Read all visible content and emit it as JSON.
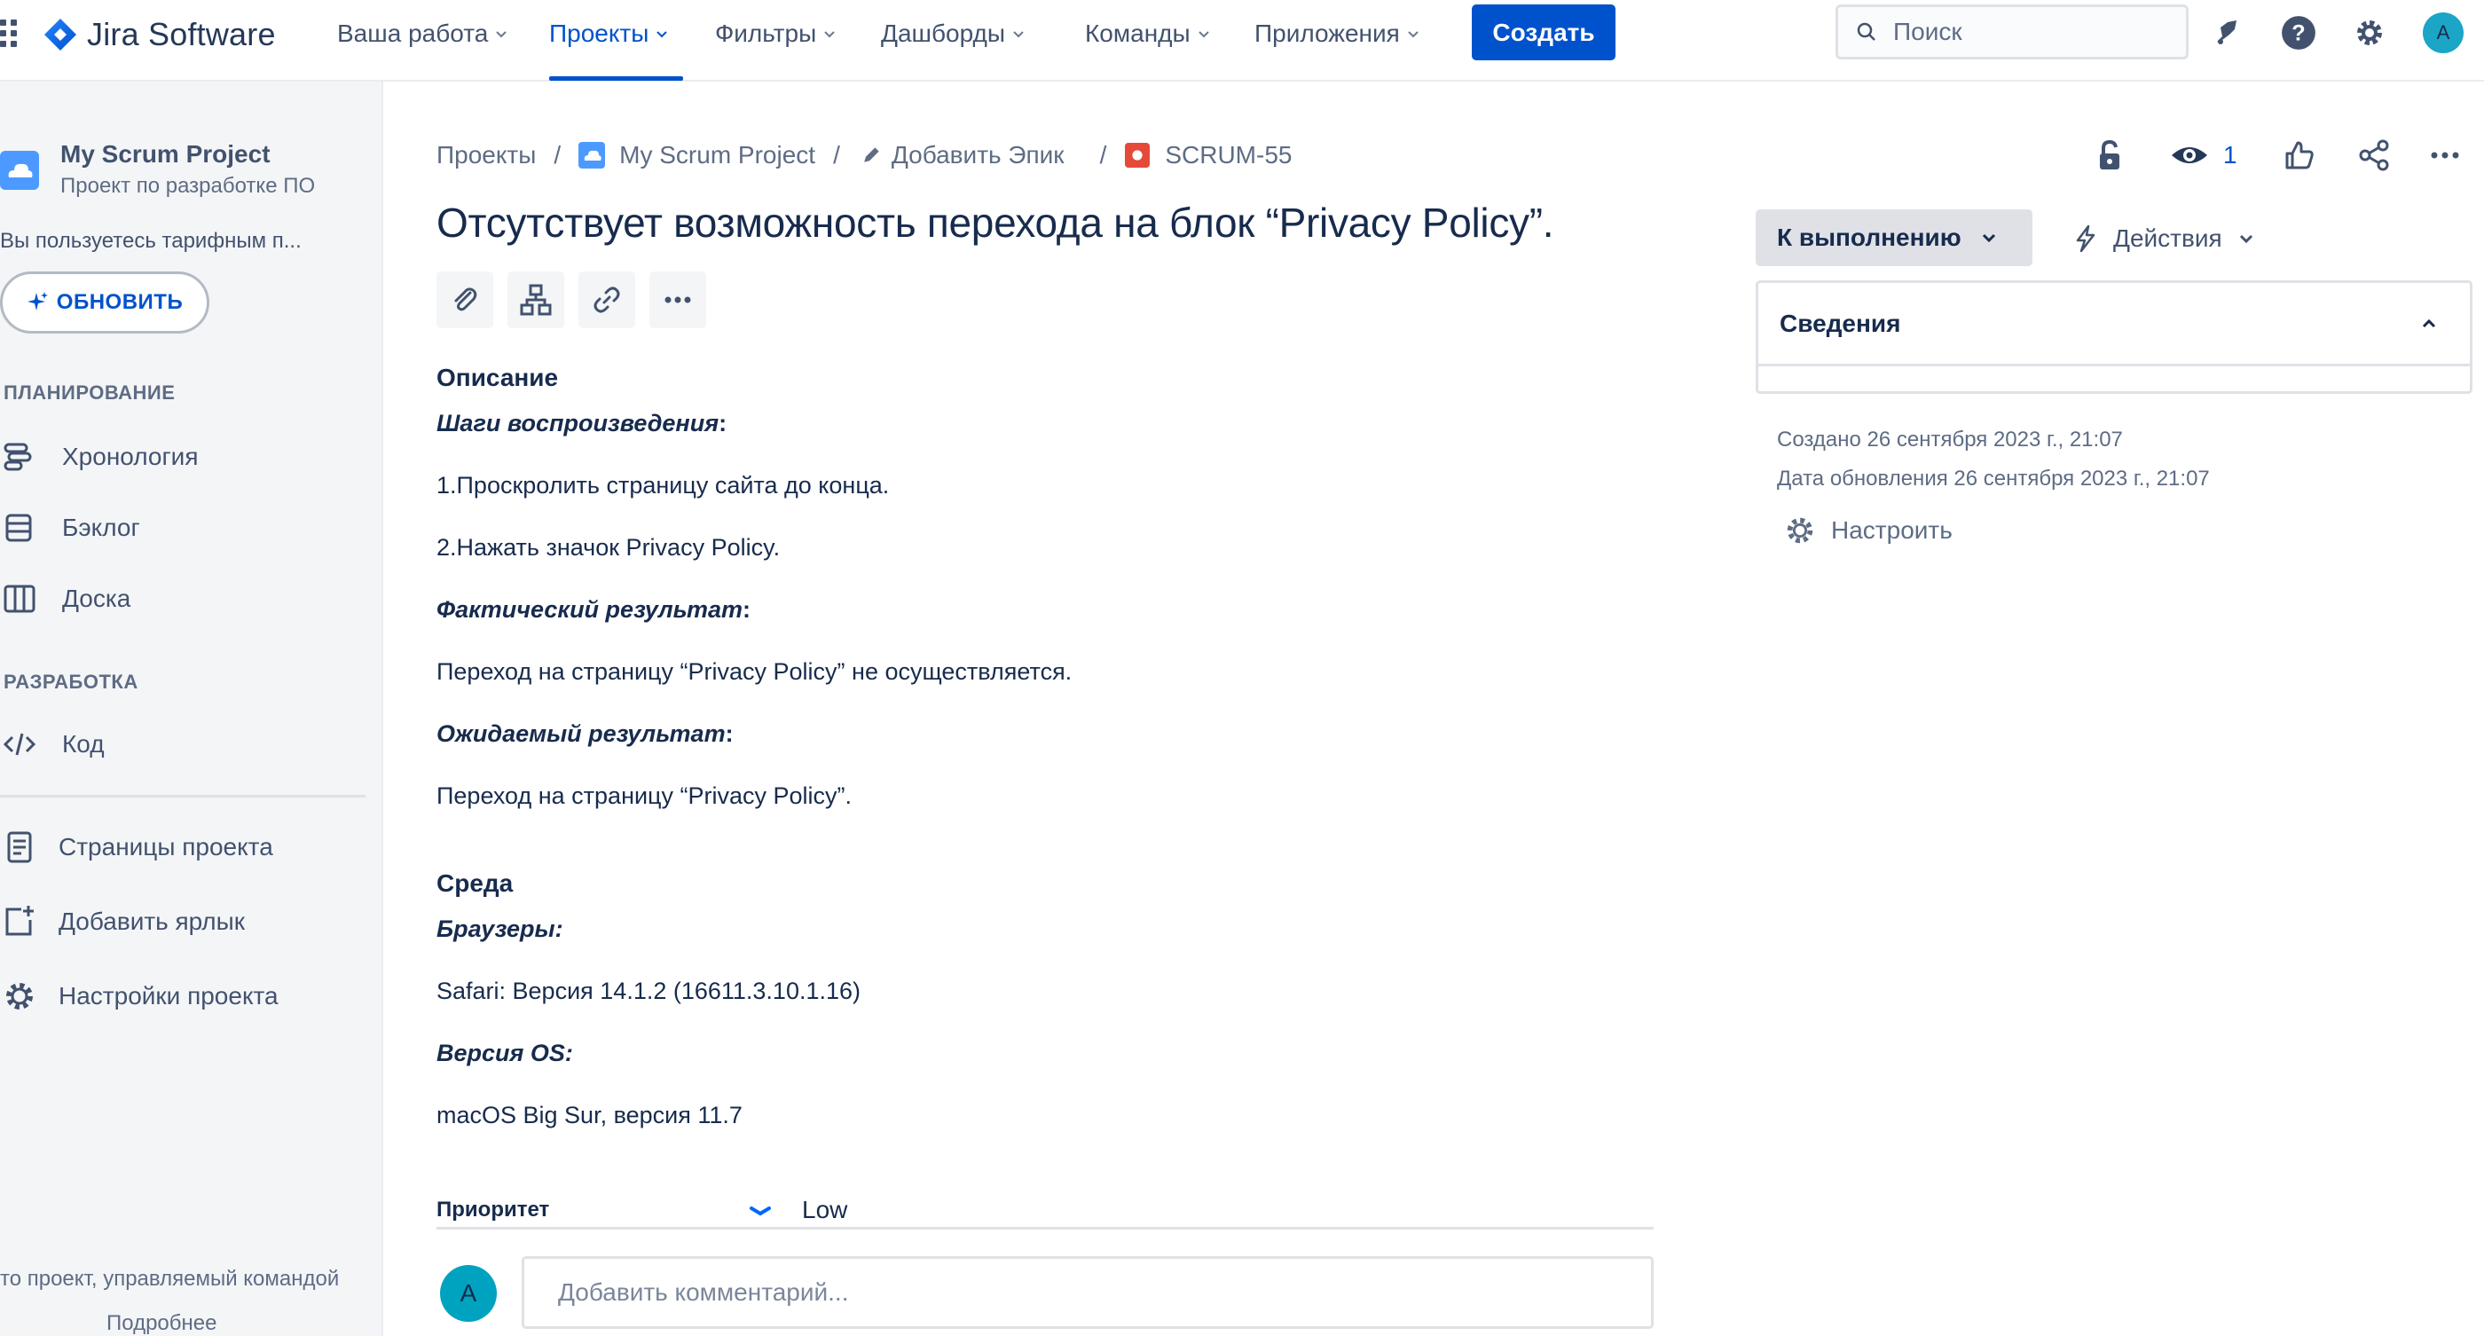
{
  "app": {
    "name": "Jira Software"
  },
  "topnav": {
    "items": [
      {
        "label": "Ваша работа"
      },
      {
        "label": "Проекты"
      },
      {
        "label": "Фильтры"
      },
      {
        "label": "Дашборды"
      },
      {
        "label": "Команды"
      },
      {
        "label": "Приложения"
      }
    ],
    "active": "Проекты",
    "create_label": "Создать",
    "search_placeholder": "Поиск",
    "avatar_initial": "A",
    "icons": [
      "notifications-icon",
      "help-icon",
      "settings-icon"
    ]
  },
  "sidebar": {
    "project_name": "My Scrum Project",
    "project_type": "Проект по разработке ПО",
    "plan_text": "Вы пользуетесь тарифным п...",
    "upgrade_label": "ОБНОВИТЬ",
    "planning_header": "ПЛАНИРОВАНИЕ",
    "planning_items": [
      {
        "label": "Хронология",
        "icon": "timeline-icon"
      },
      {
        "label": "Бэклог",
        "icon": "backlog-icon"
      },
      {
        "label": "Доска",
        "icon": "board-icon"
      }
    ],
    "dev_header": "РАЗРАБОТКА",
    "dev_items": [
      {
        "label": "Код",
        "icon": "code-icon"
      }
    ],
    "extra_items": [
      {
        "label": "Страницы проекта",
        "icon": "pages-icon"
      },
      {
        "label": "Добавить ярлык",
        "icon": "add-shortcut-icon"
      },
      {
        "label": "Настройки проекта",
        "icon": "settings-icon"
      }
    ],
    "footer_text": "то проект, управляемый командой",
    "footer_link": "Подробнее"
  },
  "breadcrumb": {
    "projects": "Проекты",
    "project": "My Scrum Project",
    "epic": "Добавить Эпик",
    "issue_key": "SCRUM-55"
  },
  "issue": {
    "title": "Отсутствует возможность перехода на блок “Privacy Policy”.",
    "description_header": "Описание",
    "steps_header": "Шаги воспроизведения",
    "step1": "1.Проскролить страницу сайта до конца.",
    "step2": "2.Нажать значок Privacy Policy.",
    "actual_header": "Фактический результат",
    "actual_text": "Переход на страницу “Privacy Policy” не осуществляется.",
    "expected_header": "Ожидаемый результат",
    "expected_text": "Переход на страницу “Privacy Policy”.",
    "env_header": "Среда",
    "browsers_header": "Браузеры:",
    "browsers_text": "Safari: Версия 14.1.2 (16611.3.10.1.16)",
    "os_header": "Версия OS:",
    "os_text": "macOS Big Sur, версия 11.7",
    "colon": ":",
    "priority_label": "Приоритет",
    "priority_value": "Low",
    "comment_placeholder": "Добавить комментарий...",
    "comment_avatar": "A"
  },
  "right_panel": {
    "watchers_count": "1",
    "status_label": "К выполнению",
    "actions_label": "Действия",
    "details_title": "Сведения",
    "created": "Создано 26 сентября 2023 г., 21:07",
    "updated": "Дата обновления 26 сентября 2023 г., 21:07",
    "configure_label": "Настроить"
  },
  "colors": {
    "accent": "#0052CC",
    "issue_type_bug": "#E5493A",
    "sidebar_bg": "#F4F5F7",
    "avatar": "#00A3BF"
  }
}
